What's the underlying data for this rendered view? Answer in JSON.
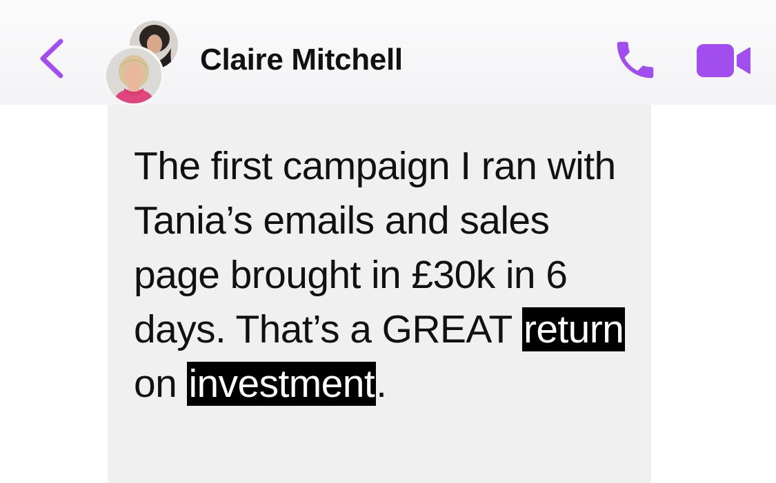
{
  "header": {
    "contact_name": "Claire Mitchell",
    "back_icon": "chevron-left-icon",
    "call_icon": "phone-icon",
    "video_icon": "video-camera-icon",
    "accent_color": "#a24dee"
  },
  "message": {
    "text_before": "The first campaign I ran with Tania’s emails and sales page brought in £30k in 6 days. That’s a GREAT ",
    "highlight_1": "return",
    "text_middle": " on ",
    "highlight_2": "investment",
    "text_after": ".",
    "bubble_color": "#f0f0f0",
    "highlight_color": "#000000"
  }
}
